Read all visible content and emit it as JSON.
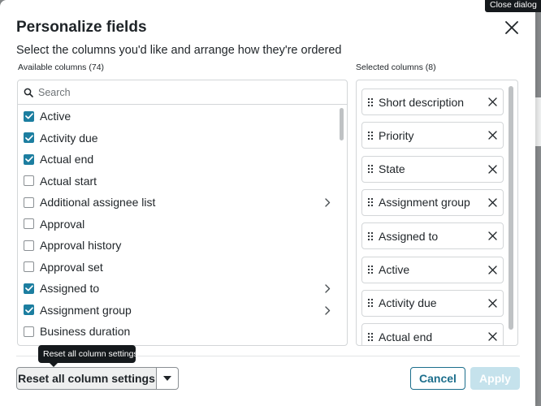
{
  "dialog": {
    "title": "Personalize fields",
    "subtitle": "Select the columns you'd like and arrange how they're ordered",
    "close_tooltip": "Close dialog"
  },
  "available": {
    "label": "Available columns (74)",
    "search_placeholder": "Search",
    "items": [
      {
        "label": "Active",
        "checked": true,
        "has_children": false
      },
      {
        "label": "Activity due",
        "checked": true,
        "has_children": false
      },
      {
        "label": "Actual end",
        "checked": true,
        "has_children": false
      },
      {
        "label": "Actual start",
        "checked": false,
        "has_children": false
      },
      {
        "label": "Additional assignee list",
        "checked": false,
        "has_children": true
      },
      {
        "label": "Approval",
        "checked": false,
        "has_children": false
      },
      {
        "label": "Approval history",
        "checked": false,
        "has_children": false
      },
      {
        "label": "Approval set",
        "checked": false,
        "has_children": false
      },
      {
        "label": "Assigned to",
        "checked": true,
        "has_children": true
      },
      {
        "label": "Assignment group",
        "checked": true,
        "has_children": true
      },
      {
        "label": "Business duration",
        "checked": false,
        "has_children": false
      }
    ]
  },
  "selected": {
    "label": "Selected columns (8)",
    "items": [
      {
        "label": "Short description"
      },
      {
        "label": "Priority"
      },
      {
        "label": "State"
      },
      {
        "label": "Assignment group"
      },
      {
        "label": "Assigned to"
      },
      {
        "label": "Active"
      },
      {
        "label": "Activity due"
      },
      {
        "label": "Actual end"
      }
    ]
  },
  "footer": {
    "reset_label": "Reset all column settings",
    "reset_tooltip": "Reset all column settings",
    "cancel_label": "Cancel",
    "apply_label": "Apply"
  },
  "colors": {
    "accent": "#1c7ea0",
    "apply_disabled": "#c5e2ec"
  }
}
